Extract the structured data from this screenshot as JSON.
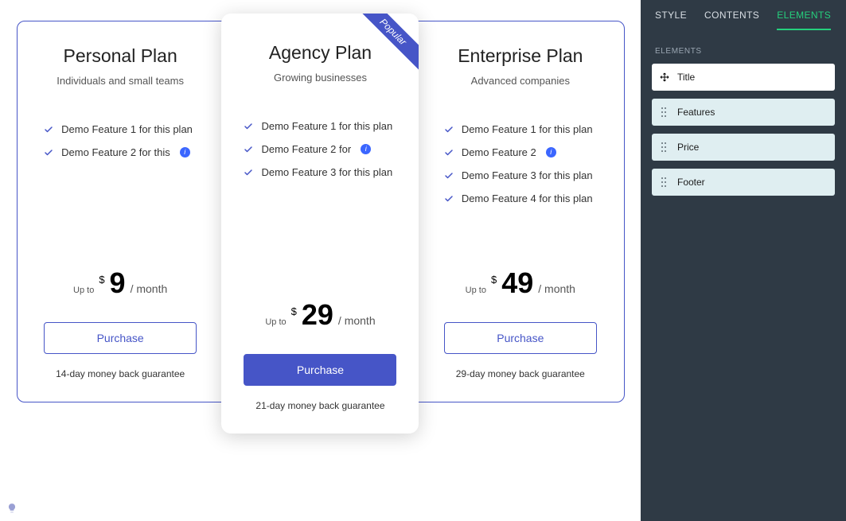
{
  "ribbon_label": "Popular",
  "plans": [
    {
      "title": "Personal Plan",
      "subtitle": "Individuals and small teams",
      "features": [
        {
          "text": "Demo Feature 1 for this plan",
          "info": false
        },
        {
          "text": "Demo Feature 2 for this",
          "info": true
        }
      ],
      "price_prefix": "Up to",
      "currency": "$",
      "amount": "9",
      "period": "/ month",
      "button": "Purchase",
      "footer": "14-day money back guarantee",
      "featured": false
    },
    {
      "title": "Agency Plan",
      "subtitle": "Growing businesses",
      "features": [
        {
          "text": "Demo Feature 1 for this plan",
          "info": false
        },
        {
          "text": "Demo Feature 2 for",
          "info": true
        },
        {
          "text": "Demo Feature 3 for this plan",
          "info": false
        }
      ],
      "price_prefix": "Up to",
      "currency": "$",
      "amount": "29",
      "period": "/ month",
      "button": "Purchase",
      "footer": "21-day money back guarantee",
      "featured": true
    },
    {
      "title": "Enterprise Plan",
      "subtitle": "Advanced companies",
      "features": [
        {
          "text": "Demo Feature 1 for this plan",
          "info": false
        },
        {
          "text": "Demo Feature 2",
          "info": true
        },
        {
          "text": "Demo Feature 3 for this plan",
          "info": false
        },
        {
          "text": "Demo Feature 4 for this plan",
          "info": false
        }
      ],
      "price_prefix": "Up to",
      "currency": "$",
      "amount": "49",
      "period": "/ month",
      "button": "Purchase",
      "footer": "29-day money back guarantee",
      "featured": false
    }
  ],
  "panel": {
    "tabs": [
      "STYLE",
      "CONTENTS",
      "ELEMENTS"
    ],
    "active_tab": 2,
    "section_label": "ELEMENTS",
    "items": [
      {
        "label": "Title",
        "active": true
      },
      {
        "label": "Features",
        "active": false
      },
      {
        "label": "Price",
        "active": false
      },
      {
        "label": "Footer",
        "active": false
      }
    ]
  }
}
